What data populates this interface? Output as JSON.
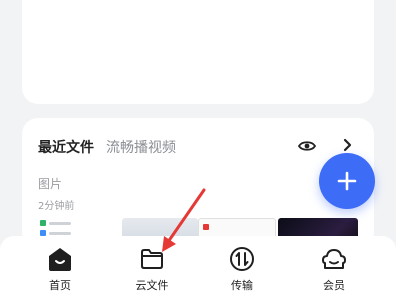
{
  "recent": {
    "tab_recent": "最近文件",
    "tab_video": "流畅播视频",
    "section_label": "图片",
    "time_label": "2分钟前"
  },
  "icons": {
    "eye": "eye-icon",
    "chevron": "chevron-right-icon",
    "add": "plus-icon",
    "home": "home-icon",
    "cloud_file": "folder-icon",
    "transfer": "transfer-icon",
    "member": "member-icon"
  },
  "tabbar": {
    "home": "首页",
    "cloud_files": "云文件",
    "transfer": "传输",
    "member": "会员"
  },
  "colors": {
    "accent": "#3d6cf7",
    "annotation_arrow": "#e53935"
  }
}
